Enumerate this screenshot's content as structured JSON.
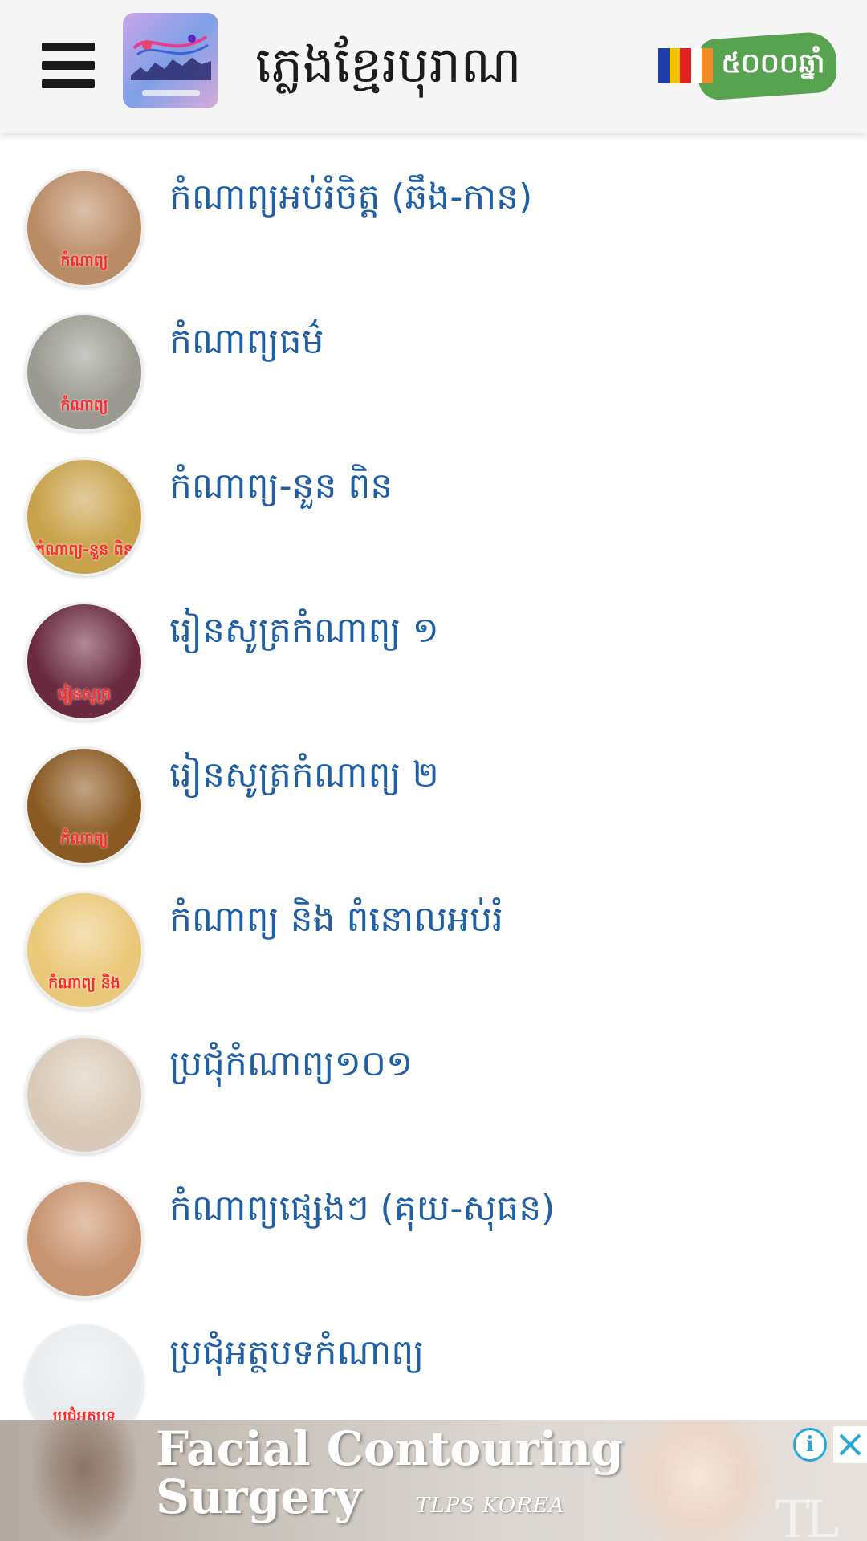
{
  "header": {
    "title": "ភ្លេងខ្មែរបុរាណ",
    "badge_text": "៥០០០ឆ្នាំ",
    "colors": {
      "flag_blue": "#1e3fa8",
      "flag_yellow": "#f3c300",
      "flag_red": "#e02222",
      "badge_green": "#58a34f"
    }
  },
  "list": {
    "items": [
      {
        "label": "កំណាព្យអប់រំចិត្ត (ឆឹង-កាន)",
        "avatar_caption": "កំណាព្យ",
        "avatar_bg": "#b98c66"
      },
      {
        "label": "កំណាព្យធម៌",
        "avatar_caption": "កំណាព្យ",
        "avatar_bg": "#9a9a92"
      },
      {
        "label": "កំណាព្យ-នួន ពិន",
        "avatar_caption": "កំណាព្យ-នួន ពិន",
        "avatar_bg": "#c7a24a"
      },
      {
        "label": "រៀនសូត្រកំណាព្យ ១",
        "avatar_caption": "រៀនសូត្រ",
        "avatar_bg": "#6a2a40"
      },
      {
        "label": "រៀនសូត្រកំណាព្យ ២",
        "avatar_caption": "កំណាព្យ",
        "avatar_bg": "#8a5a22"
      },
      {
        "label": "កំណាព្យ និង ពំនោលអប់រំ",
        "avatar_caption": "កំណាព្យ និង",
        "avatar_bg": "#e9c879"
      },
      {
        "label": "ប្រជុំកំណាព្យ១០១",
        "avatar_caption": "",
        "avatar_bg": "#d9c9b8"
      },
      {
        "label": "កំណាព្យផ្សេងៗ (គុយ-សុធន)",
        "avatar_caption": "",
        "avatar_bg": "#c89470"
      },
      {
        "label": "ប្រជុំអត្ថបទកំណាព្យ",
        "avatar_caption": "ប្រជុំអត្ថបទ",
        "avatar_bg": "#e8ecee"
      }
    ],
    "label_color": "#1e5fa6"
  },
  "ad": {
    "headline": "Facial Contouring\nSurgery",
    "brand": "TLPS KOREA",
    "info_label": "i",
    "corner_mark": "TL"
  }
}
